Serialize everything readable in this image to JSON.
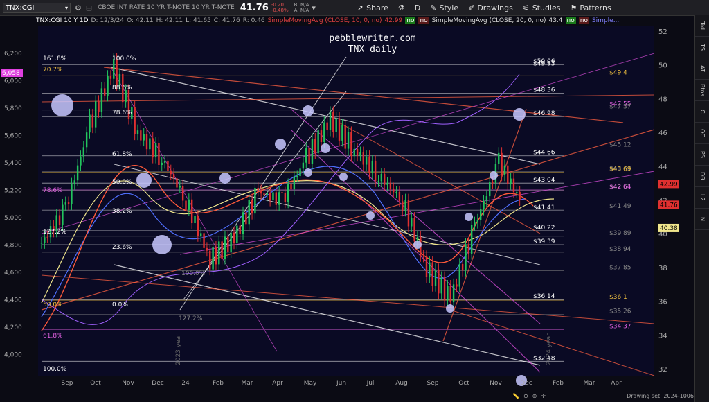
{
  "toolbar": {
    "symbol": "TNX:CGI",
    "description": "CBOE INT RATE 10 YR T-NOTE   10 YR T-NOTE",
    "price": "41.76",
    "change": "-0.20",
    "change_pct": "-0.48%",
    "bid": "B: N/A",
    "ask": "A: N/A",
    "share_label": "Share",
    "timeframe_label": "D",
    "style_label": "Style",
    "drawings_label": "Drawings",
    "studies_label": "Studies",
    "patterns_label": "Patterns"
  },
  "infobar": {
    "symbol": "TNX:CGI 10 Y 1D",
    "date": "D: 12/3/24",
    "open": "O: 42.11",
    "high": "H: 42.11",
    "low": "L: 41.65",
    "close": "C: 41.76",
    "range": "R: 0.46",
    "sma1": "SimpleMovingAvg (CLOSE, 10, 0, no)",
    "sma1_value": "42.99",
    "sma2": "SimpleMovingAvg (CLOSE, 20, 0, no)",
    "sma2_value": "43.4",
    "sma3": "Simple...",
    "no_label": "no"
  },
  "watermark": {
    "line1": "pebblewriter.com",
    "line2": "TNX daily"
  },
  "chart_data": {
    "type": "candlestick",
    "right_axis_ticks": [
      "52",
      "50",
      "48",
      "46",
      "44",
      "42",
      "40",
      "38",
      "36",
      "34",
      "32"
    ],
    "left_axis_ticks": [
      "6,200",
      "6,000",
      "5,800",
      "5,600",
      "5,400",
      "5,200",
      "5,000",
      "4,800",
      "4,600",
      "4,400",
      "4,200",
      "4,000"
    ],
    "x_ticks": [
      "Sep",
      "Oct",
      "Nov",
      "Dec",
      "24",
      "Feb",
      "Mar",
      "Apr",
      "May",
      "Jun",
      "Jul",
      "Aug",
      "Sep",
      "Oct",
      "Nov",
      "Dec",
      "Feb",
      "Mar",
      "Apr"
    ],
    "year_labels": [
      "2023 year",
      "2024 year"
    ],
    "left_fib_labels": [
      "161.8%",
      "100.0%",
      "70.7%",
      "88.6%",
      "78.6%",
      "61.8%",
      "78.6%",
      "50.0%",
      "38.2%",
      "127.2%",
      "23.6%",
      "50.0%",
      "0.0%",
      "61.8%",
      "100.0%",
      "127.2%",
      "100.0%"
    ],
    "right_levels": [
      {
        "label": "$50.06",
        "value": 50.06,
        "color": "#ffffff"
      },
      {
        "label": "$49.93",
        "value": 49.93,
        "color": "#ffffff"
      },
      {
        "label": "$49.4",
        "value": 49.4,
        "color": "#f0c040"
      },
      {
        "label": "$48.36",
        "value": 48.36,
        "color": "#ffffff"
      },
      {
        "label": "$47.55",
        "value": 47.55,
        "color": "#e060e0"
      },
      {
        "label": "$47.37",
        "value": 47.37,
        "color": "#888888"
      },
      {
        "label": "$46.98",
        "value": 46.98,
        "color": "#ffffff"
      },
      {
        "label": "$45.12",
        "value": 45.12,
        "color": "#888888"
      },
      {
        "label": "$44.66",
        "value": 44.66,
        "color": "#ffffff"
      },
      {
        "label": "$43.73",
        "value": 43.73,
        "color": "#888888"
      },
      {
        "label": "$43.69",
        "value": 43.69,
        "color": "#f0c040"
      },
      {
        "label": "$43.04",
        "value": 43.04,
        "color": "#ffffff"
      },
      {
        "label": "$42.61",
        "value": 42.61,
        "color": "#888888"
      },
      {
        "label": "$42.64",
        "value": 42.64,
        "color": "#e060e0"
      },
      {
        "label": "$41.49",
        "value": 41.49,
        "color": "#888888"
      },
      {
        "label": "$41.41",
        "value": 41.41,
        "color": "#ffffff"
      },
      {
        "label": "$40.22",
        "value": 40.22,
        "color": "#ffffff"
      },
      {
        "label": "$39.89",
        "value": 39.89,
        "color": "#888888"
      },
      {
        "label": "$39.39",
        "value": 39.39,
        "color": "#ffffff"
      },
      {
        "label": "$38.94",
        "value": 38.94,
        "color": "#888888"
      },
      {
        "label": "$37.85",
        "value": 37.85,
        "color": "#888888"
      },
      {
        "label": "$36.14",
        "value": 36.14,
        "color": "#ffffff"
      },
      {
        "label": "$36.1",
        "value": 36.1,
        "color": "#f0c040"
      },
      {
        "label": "$35.26",
        "value": 35.26,
        "color": "#888888"
      },
      {
        "label": "$34.37",
        "value": 34.37,
        "color": "#e060e0"
      },
      {
        "label": "$32.48",
        "value": 32.48,
        "color": "#ffffff"
      }
    ],
    "price_tags": [
      {
        "label": "42.99",
        "value": 42.99,
        "color": "#e03030"
      },
      {
        "label": "41.76",
        "value": 41.76,
        "color": "#e03030"
      },
      {
        "label": "40.38",
        "value": 40.38,
        "color": "#f0e68c"
      }
    ],
    "left_tag": {
      "label": "6,058",
      "value": 6058,
      "color": "#e040e0"
    },
    "close_series": [
      {
        "t": "Aug",
        "v": 39.5
      },
      {
        "t": "Sep",
        "v": 41.5
      },
      {
        "t": "Oct",
        "v": 46.5
      },
      {
        "t": "Oct",
        "v": 49.9
      },
      {
        "t": "Nov",
        "v": 46.0
      },
      {
        "t": "Nov",
        "v": 44.5
      },
      {
        "t": "Dec",
        "v": 42.0
      },
      {
        "t": "Dec",
        "v": 38.5
      },
      {
        "t": "24",
        "v": 39.8
      },
      {
        "t": "Feb",
        "v": 42.5
      },
      {
        "t": "Mar",
        "v": 42.0
      },
      {
        "t": "Apr",
        "v": 44.5
      },
      {
        "t": "Apr",
        "v": 46.8
      },
      {
        "t": "May",
        "v": 45.0
      },
      {
        "t": "Jun",
        "v": 43.5
      },
      {
        "t": "Jul",
        "v": 42.0
      },
      {
        "t": "Aug",
        "v": 38.0
      },
      {
        "t": "Sep",
        "v": 36.2
      },
      {
        "t": "Oct",
        "v": 40.5
      },
      {
        "t": "Nov",
        "v": 44.3
      },
      {
        "t": "Dec",
        "v": 41.76
      }
    ]
  },
  "sidebar": {
    "tabs": [
      "Trd",
      "TS",
      "AT",
      "Btns",
      "C",
      "OC",
      "PS",
      "DB",
      "L2",
      "N"
    ]
  },
  "status": {
    "drawing_set": "Drawing set: 2024-1006"
  }
}
